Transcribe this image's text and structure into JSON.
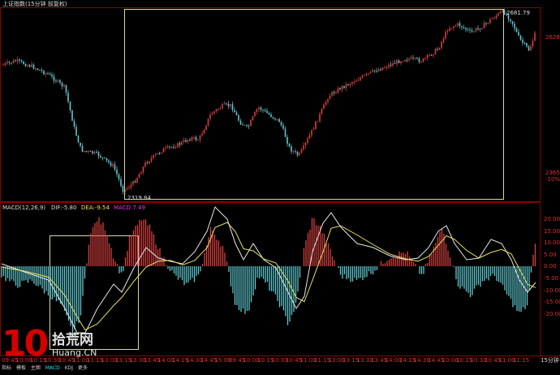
{
  "window": {
    "title": "上证指数(15分钟 前复权)"
  },
  "price_panel": {
    "high_label": "2681.79",
    "low_label": "2319.84",
    "y_labels": [
      "2628",
      "2365",
      "-10%"
    ]
  },
  "macd_panel": {
    "title": "MACD(12,26,9)",
    "dif_label": "DIF:-5.80",
    "dea_label": "DEA:-9.54",
    "macd_label": "MACD:7.49",
    "y_labels": [
      "20.00",
      "15.00",
      "10.00",
      "5.00",
      "0.00",
      "-5.00",
      "-10.00",
      "-15.00",
      "-20.00"
    ]
  },
  "time_axis": {
    "labels": [
      "09:45",
      "10:00",
      "10:15",
      "10:30",
      "10:45",
      "11:00",
      "11:15",
      "13:00",
      "13:15",
      "13:30",
      "13:45",
      "14:00",
      "14:15",
      "14:30",
      "14:45",
      "15:00",
      "09:45",
      "10:00",
      "10:15",
      "10:30",
      "10:45",
      "11:00",
      "11:15",
      "13:00",
      "13:15",
      "13:30",
      "13:45",
      "14:00",
      "14:15",
      "14:30",
      "14:45",
      "10:00",
      "10:15",
      "10:30",
      "10:45",
      "11:00",
      "11:15"
    ],
    "period_label": "15分钟"
  },
  "bottom_tabs": [
    "指标",
    "模板",
    "主图",
    "MACD",
    "KDJ",
    "更多"
  ],
  "watermark": {
    "number": "10",
    "chinese": "拾荒网",
    "url": "Huang.CN"
  },
  "colors": {
    "up": "#d94040",
    "down": "#60c8d0",
    "dif_line": "#e8e8e8",
    "dea_line": "#e8e060",
    "frame": "#8b0000",
    "box": "#d8d8a0",
    "macd_label": "#e040e0"
  }
}
